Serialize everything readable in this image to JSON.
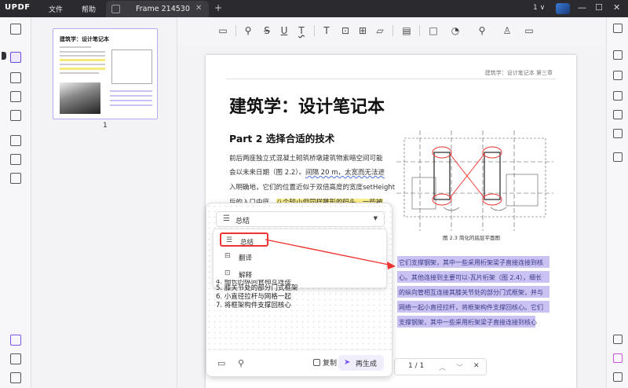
{
  "titlebar": {
    "logo": "UPDF",
    "menu": [
      "文件",
      "帮助"
    ],
    "tab_title": "Frame 214530",
    "tab_close": "✕",
    "add_tab": "+",
    "version_badge": "1 ∨",
    "window_buttons": [
      "—",
      "☐",
      "✕"
    ]
  },
  "thumbnails": {
    "page_number": "1"
  },
  "document": {
    "running_head": "建筑学：设计笔记本 第三章",
    "title": "建筑学：设计笔记本",
    "part_heading": "Part 2   选择合适的技术",
    "paragraph": {
      "line1": "前后两座独立式混凝土砌筑桥墩建筑物索暗空间可能",
      "line2_a": "会以未来日期（图 2.2）。",
      "line2_b": "间隔 20 m，太宽而无法进",
      "line3": "入明确地，它们的位置近似于双倍高度的宽度setHeight",
      "line4_a": "后的入口中庭。",
      "line4_b": "八个较小但同样雕形的码头，一些被"
    },
    "selected_lines": [
      "它们支撑钢架，其中一些采用桁架梁子直接连接到核",
      "心。其他连接到主要可以-瓦片桁架（图 2.4），细长",
      "的纵向管相互连接其膝关节处的部分门式框架，并与",
      "网络一起小直径拉杆，将框架构件支撑回核心。它们",
      "支撑钢架，其中一些采用桁架梁子直接连接到核心"
    ],
    "figure_caption": "图 2.3  简化的底层平面图"
  },
  "page_nav": {
    "current": "1 / 1",
    "up": "︿",
    "down": "﹀",
    "close": "✕"
  },
  "ai_panel": {
    "selected_mode": "总结",
    "options": [
      {
        "icon": "list-icon",
        "label": "总结"
      },
      {
        "icon": "translate-icon",
        "label": "翻译"
      },
      {
        "icon": "explain-icon",
        "label": "解释"
      }
    ],
    "list_items": [
      "4. 细长的纵向管相互连接",
      "5. 膝关节处的部分门式框架",
      "6. 小直径拉杆与网格一起",
      "7. 将框架构件支撑回核心"
    ],
    "copy_label": "复制",
    "regenerate_label": "再生成"
  },
  "colors": {
    "accent": "#7b55f0",
    "selection": "#c9c2f2",
    "highlight": "#fbf08a",
    "annotation_red": "#e33333"
  }
}
